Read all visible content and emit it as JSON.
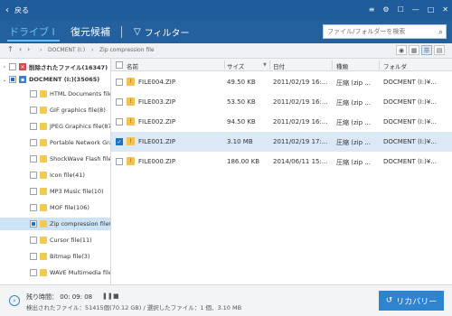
{
  "titlebar": {
    "back_label": "戻る",
    "icons": [
      "back-arrow-icon",
      "menu-icon",
      "gear-icon",
      "feedback-icon",
      "minimize-icon",
      "maximize-icon",
      "close-icon"
    ]
  },
  "tabs": [
    {
      "label": "ドライブ I",
      "active": true
    },
    {
      "label": "復元候補",
      "active": false
    }
  ],
  "filter": {
    "label": "フィルター",
    "icon": "filter-icon"
  },
  "search": {
    "placeholder": "ファイル/フォルダーを検索",
    "value": ""
  },
  "breadcrumb": {
    "items": [
      "DOCMENT (I:)",
      "Zip compression file"
    ],
    "nav_icons": [
      "up-arrow-icon",
      "back-arrow-icon",
      "forward-arrow-icon"
    ]
  },
  "view_buttons": [
    "preview-icon",
    "list-view-icon",
    "detail-view-icon",
    "grid-view-icon"
  ],
  "tree": [
    {
      "label": "削除されたファイル(16347)",
      "level": 0,
      "expand": ">",
      "icon": "trash-icon",
      "checked": "none",
      "bold": true
    },
    {
      "label": "DOCMENT (I:)(35065)",
      "level": 0,
      "expand": "v",
      "icon": "disk-icon",
      "checked": "partial",
      "bold": true
    },
    {
      "label": "HTML Documents file(",
      "level": 1,
      "checked": "none"
    },
    {
      "label": "GIF graphics file(8)",
      "level": 1,
      "checked": "none"
    },
    {
      "label": "JPEG Graphics file(87)",
      "level": 1,
      "checked": "none"
    },
    {
      "label": "Portable Network Gra",
      "level": 1,
      "checked": "none"
    },
    {
      "label": "ShockWave Flash file(",
      "level": 1,
      "checked": "none"
    },
    {
      "label": "Icon file(41)",
      "level": 1,
      "checked": "none"
    },
    {
      "label": "MP3 Music file(10)",
      "level": 1,
      "checked": "none"
    },
    {
      "label": "MOF file(106)",
      "level": 1,
      "checked": "none"
    },
    {
      "label": "Zip compression file(5",
      "level": 1,
      "checked": "partial",
      "selected": true
    },
    {
      "label": "Cursor file(11)",
      "level": 1,
      "checked": "none"
    },
    {
      "label": "Bitmap file(3)",
      "level": 1,
      "checked": "none"
    },
    {
      "label": "WAVE Multimedia file",
      "level": 1,
      "checked": "none"
    }
  ],
  "columns": {
    "name": "名前",
    "size": "サイズ",
    "date": "日付",
    "type": "種類",
    "folder": "フォルダ"
  },
  "files": [
    {
      "name": "FILE004.ZIP",
      "size": "49.50 KB",
      "date": "2011/02/19 16:...",
      "type": "圧縮 (zip ...",
      "folder": "DOCMENT (I:)¥...",
      "checked": false
    },
    {
      "name": "FILE003.ZIP",
      "size": "53.50 KB",
      "date": "2011/02/19 16:...",
      "type": "圧縮 (zip ...",
      "folder": "DOCMENT (I:)¥...",
      "checked": false
    },
    {
      "name": "FILE002.ZIP",
      "size": "94.50 KB",
      "date": "2011/02/19 16:...",
      "type": "圧縮 (zip ...",
      "folder": "DOCMENT (I:)¥...",
      "checked": false
    },
    {
      "name": "FILE001.ZIP",
      "size": "3.10 MB",
      "date": "2011/02/19 17:...",
      "type": "圧縮 (zip ...",
      "folder": "DOCMENT (I:)¥...",
      "checked": true
    },
    {
      "name": "FILE000.ZIP",
      "size": "186.00 KB",
      "date": "2014/06/11 15:...",
      "type": "圧縮 (zip ...",
      "folder": "DOCMENT (I:)¥...",
      "checked": false
    }
  ],
  "status": {
    "remaining_label": "残り時間：",
    "remaining_time": "00: 09: 08",
    "found_text": "検出されたファイル：51415個(70.12 GB) / 選択したファイル：1 個、3.10 MB",
    "controls": [
      "pause-icon",
      "stop-icon"
    ]
  },
  "recover_button": {
    "label": "リカバリー",
    "icon": "recover-icon"
  },
  "colors": {
    "titlebar": "#1e5c9b",
    "accent": "#2f84d1",
    "selected_row": "#dbe9f7"
  }
}
